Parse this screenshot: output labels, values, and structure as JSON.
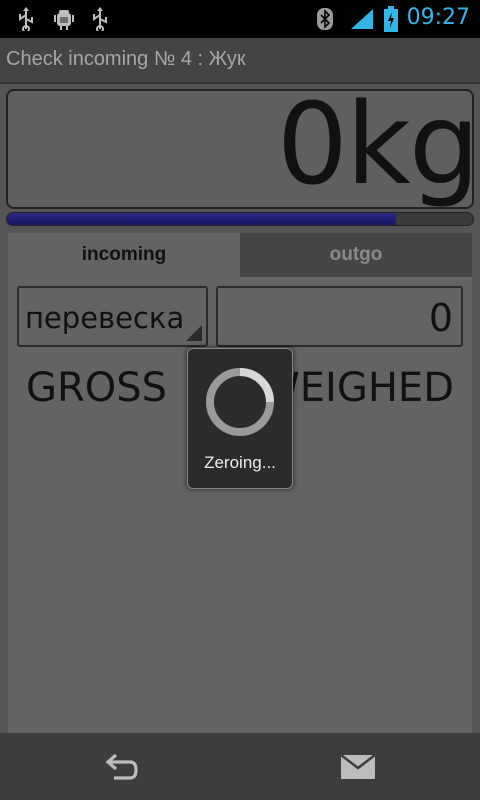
{
  "status_bar": {
    "time": "09:27",
    "icons": [
      "usb-icon",
      "android-debug-icon",
      "usb-icon",
      "bluetooth-icon",
      "signal-icon",
      "battery-charging-icon"
    ],
    "accent": "#33b5e5"
  },
  "app": {
    "title": "Check incoming № 4 : Жук"
  },
  "weight": {
    "display": "0kg",
    "progress": 0.835,
    "progress_color": "#1e1e78"
  },
  "tabs": [
    {
      "label": "incoming",
      "selected": true
    },
    {
      "label": "outgo",
      "selected": false
    }
  ],
  "form": {
    "spinner_value": "перевеска",
    "number_value": "0"
  },
  "labels": {
    "gross": "GROSS",
    "weighed": "WEIGHED"
  },
  "dialog": {
    "message": "Zeroing..."
  },
  "nav": {
    "icons": [
      "back-icon",
      "mail-icon"
    ]
  }
}
